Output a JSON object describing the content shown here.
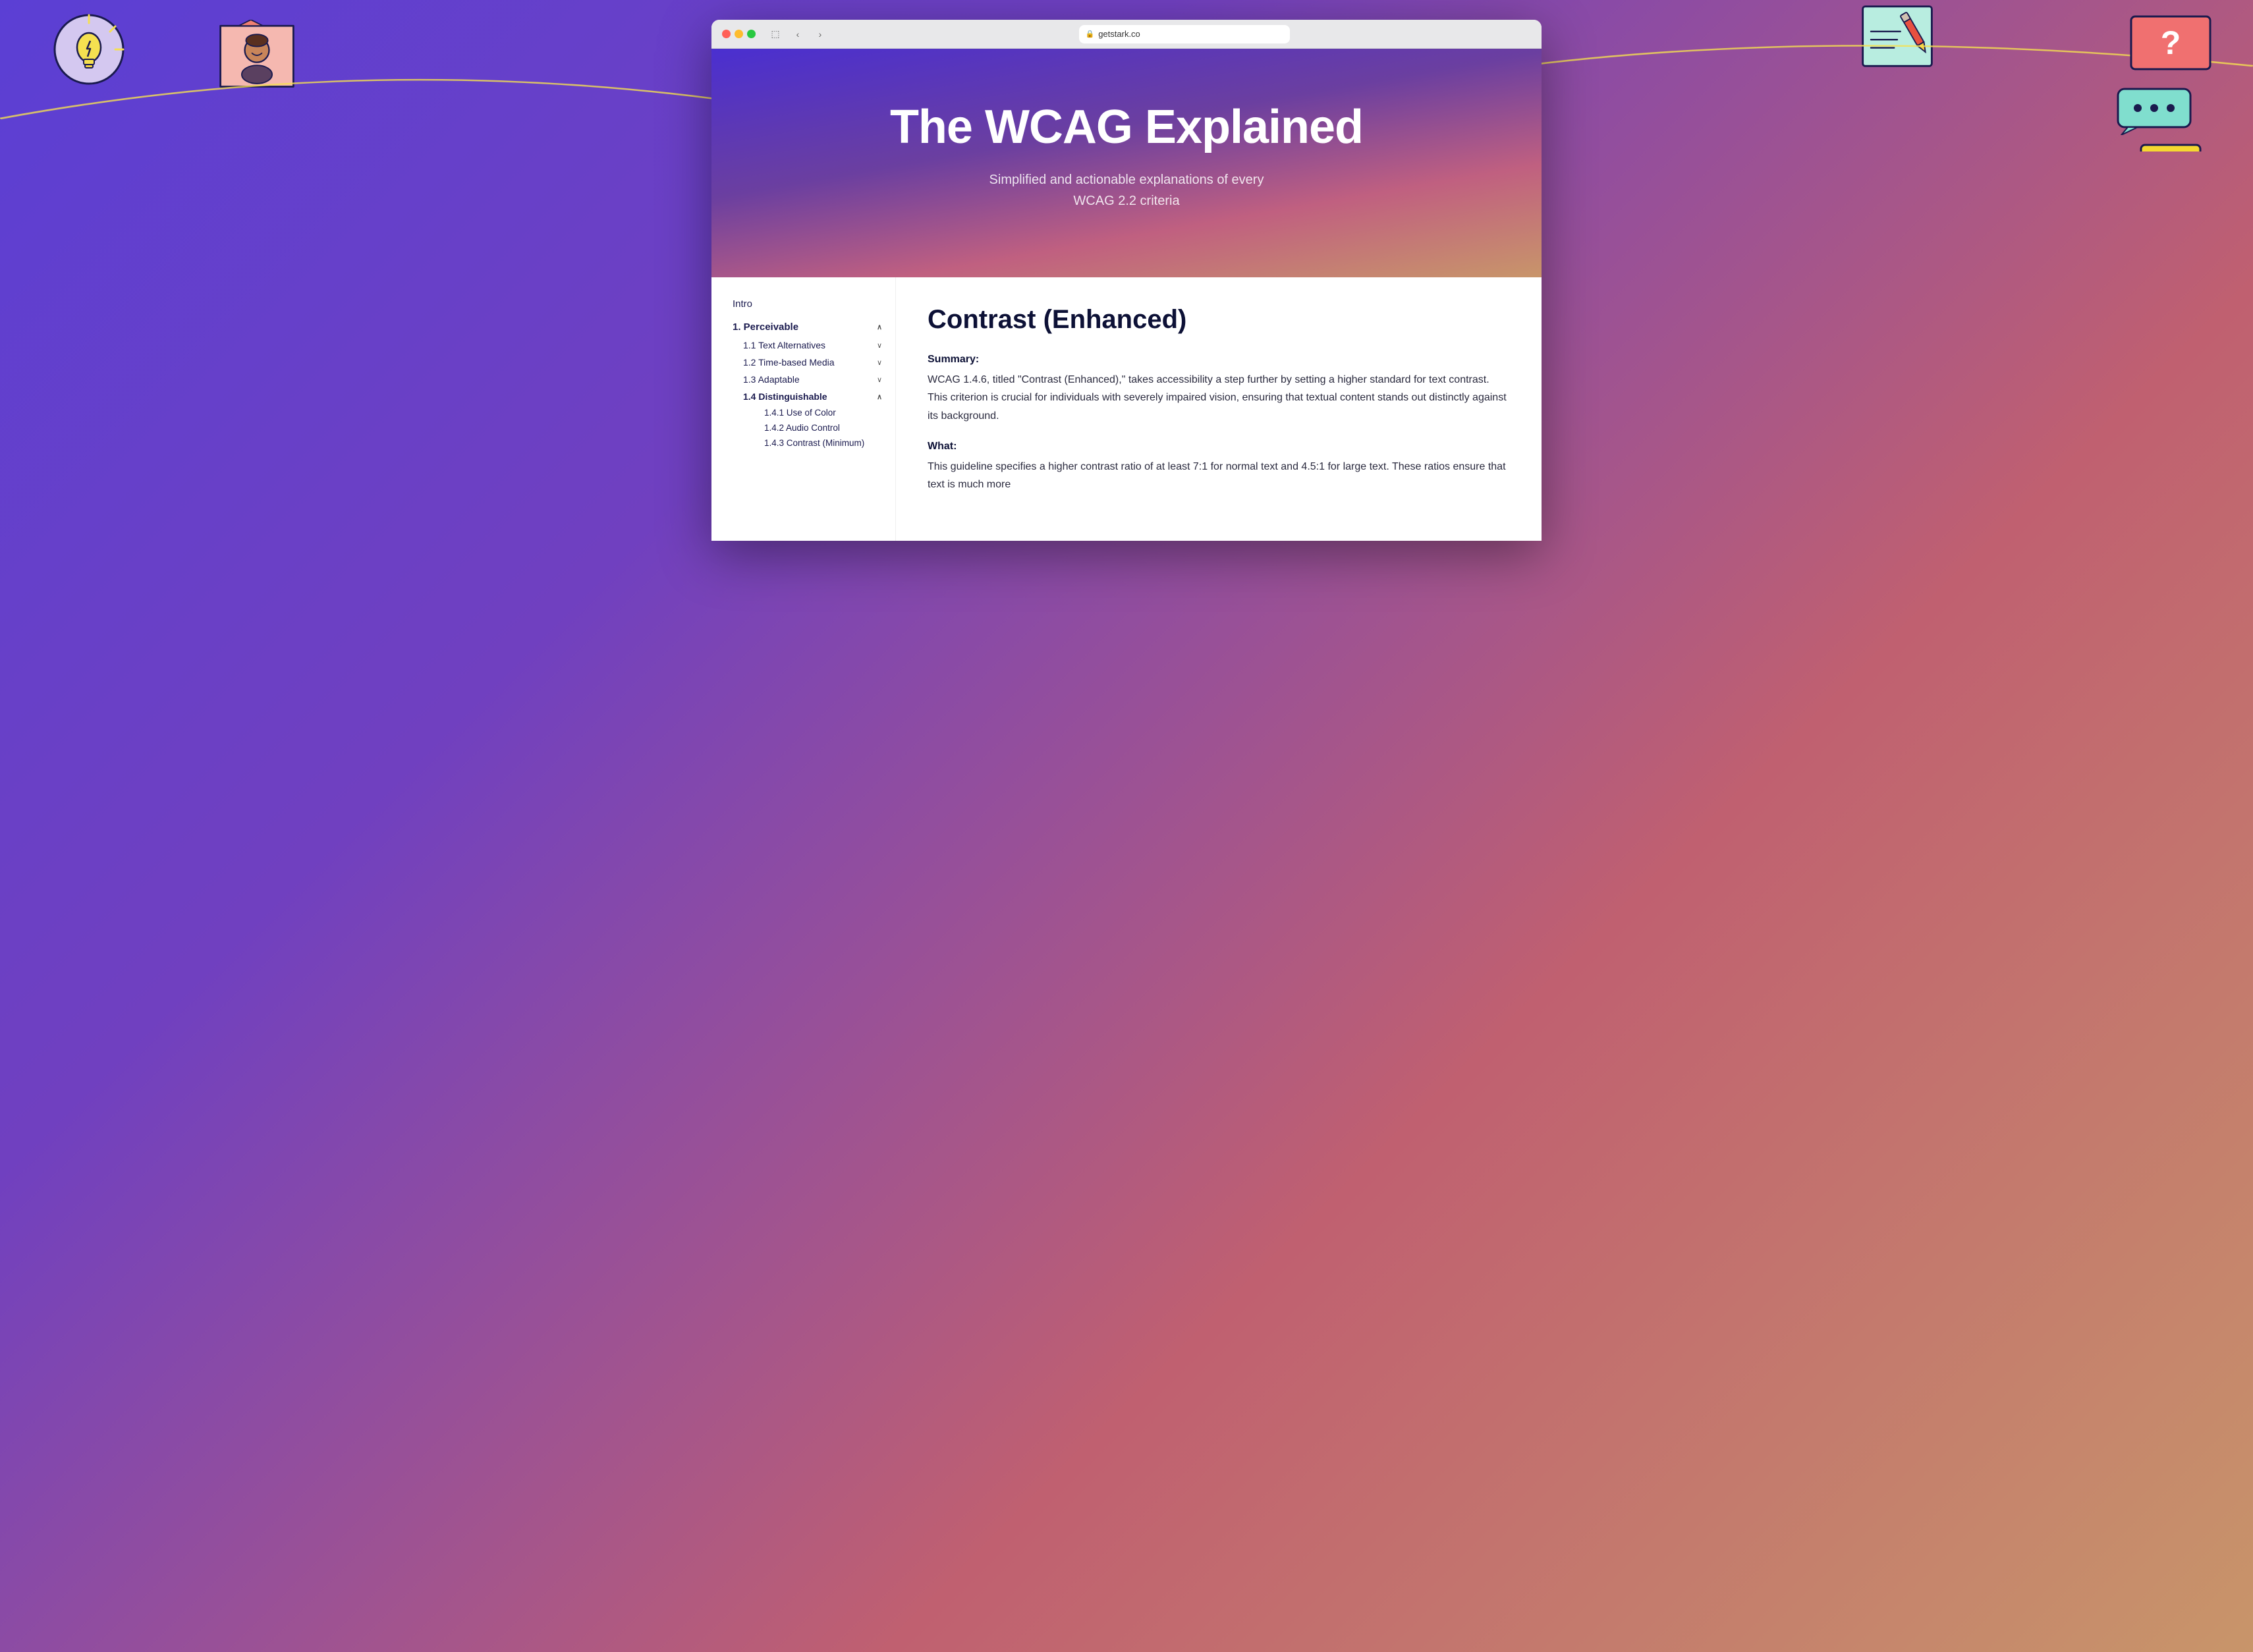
{
  "page": {
    "background_gradient_start": "#5b3fd4",
    "background_gradient_end": "#c8956a"
  },
  "browser": {
    "url": "getstark.co",
    "back_label": "‹",
    "forward_label": "›"
  },
  "hero": {
    "title": "The WCAG Explained",
    "subtitle_line1": "Simplified and actionable explanations of every",
    "subtitle_line2": "WCAG 2.2 criteria"
  },
  "sidebar": {
    "intro_label": "Intro",
    "section1": {
      "label": "1. Perceivable",
      "expanded": true,
      "chevron": "∧",
      "items": [
        {
          "label": "1.1 Text Alternatives",
          "chevron": "∨",
          "expanded": false
        },
        {
          "label": "1.2 Time-based Media",
          "chevron": "∨",
          "expanded": false
        },
        {
          "label": "1.3 Adaptable",
          "chevron": "∨",
          "expanded": false
        },
        {
          "label": "1.4 Distinguishable",
          "chevron": "∧",
          "expanded": true
        }
      ],
      "subitems": [
        {
          "label": "1.4.1 Use of Color"
        },
        {
          "label": "1.4.2 Audio Control"
        },
        {
          "label": "1.4.3 Contrast (Minimum)"
        }
      ]
    }
  },
  "main": {
    "title": "Contrast (Enhanced)",
    "summary_label": "Summary:",
    "summary_text": "WCAG 1.4.6, titled \"Contrast (Enhanced),\" takes accessibility a step further by setting a higher standard for text contrast. This criterion is crucial for individuals with severely impaired vision, ensuring that textual content stands out distinctly against its background.",
    "what_label": "What:",
    "what_text": "This guideline specifies a higher contrast ratio of at least 7:1 for normal text and 4.5:1 for large text. These ratios ensure that text is much more"
  }
}
